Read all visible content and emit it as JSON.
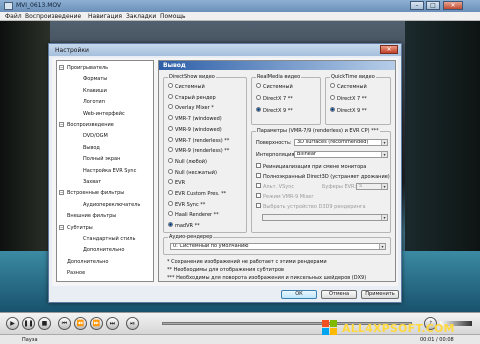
{
  "window": {
    "title": "MVI_0613.MOV",
    "min_label": "–",
    "max_label": "□",
    "close_label": "✕"
  },
  "menu": [
    "Файл",
    "Воспроизведение",
    "Навигация",
    "Закладки",
    "Помощь"
  ],
  "dialog": {
    "title": "Настройки",
    "close_label": "✕",
    "tree": [
      {
        "label": "Проигрыватель",
        "level": 0,
        "expander": "−"
      },
      {
        "label": "Форматы",
        "level": 1
      },
      {
        "label": "Клавиши",
        "level": 1
      },
      {
        "label": "Логотип",
        "level": 1
      },
      {
        "label": "Web-интерфейс",
        "level": 1
      },
      {
        "label": "Воспроизведение",
        "level": 0,
        "expander": "−"
      },
      {
        "label": "DVD/OGM",
        "level": 1
      },
      {
        "label": "Вывод",
        "level": 1
      },
      {
        "label": "Полный экран",
        "level": 1
      },
      {
        "label": "Настройка EVR Sync",
        "level": 1
      },
      {
        "label": "Захват",
        "level": 1
      },
      {
        "label": "Встроенные фильтры",
        "level": 0,
        "expander": "−"
      },
      {
        "label": "Аудиопереключатель",
        "level": 1
      },
      {
        "label": "Внешние фильтры",
        "level": 0
      },
      {
        "label": "Субтитры",
        "level": 0,
        "expander": "−"
      },
      {
        "label": "Стандартный стиль",
        "level": 1
      },
      {
        "label": "Дополнительно",
        "level": 1
      },
      {
        "label": "Дополнительно",
        "level": 0
      },
      {
        "label": "Разное",
        "level": 0
      }
    ],
    "panel_header": "Вывод",
    "directshow": {
      "title": "DirectShow видео",
      "options": [
        {
          "label": "Системный",
          "selected": false
        },
        {
          "label": "Старый рендер",
          "selected": false
        },
        {
          "label": "Overlay Mixer *",
          "selected": false
        },
        {
          "label": "VMR-7 (windowed)",
          "selected": false
        },
        {
          "label": "VMR-9 (windowed)",
          "selected": false
        },
        {
          "label": "VMR-7 (renderless) **",
          "selected": false
        },
        {
          "label": "VMR-9 (renderless) **",
          "selected": false
        },
        {
          "label": "Null (любой)",
          "selected": false
        },
        {
          "label": "Null (несжатый)",
          "selected": false
        },
        {
          "label": "EVR",
          "selected": false
        },
        {
          "label": "EVR Custom Pres. **",
          "selected": false
        },
        {
          "label": "EVR Sync **",
          "selected": false
        },
        {
          "label": "Haali Renderer **",
          "selected": false
        },
        {
          "label": "madVR **",
          "selected": true
        }
      ]
    },
    "realmedia": {
      "title": "RealMedia видео",
      "options": [
        {
          "label": "Системный",
          "selected": false
        },
        {
          "label": "DirectX 7 **",
          "selected": false
        },
        {
          "label": "DirectX 9 **",
          "selected": true
        }
      ]
    },
    "quicktime": {
      "title": "QuickTime видео",
      "options": [
        {
          "label": "Системный",
          "selected": false
        },
        {
          "label": "DirectX 7 **",
          "selected": false
        },
        {
          "label": "DirectX 9 **",
          "selected": true
        }
      ]
    },
    "params": {
      "title": "Параметры (VMR-7/9 (renderless) и EVR CP) ***",
      "surface_label": "Поверхность:",
      "surface_value": "3D surfaces (recommended)",
      "interp_label": "Интерполяция:",
      "interp_value": "Bilinear",
      "reinit_label": "Реинициализация при смене монитора",
      "d3d_label": "Полноэкранный Direct3D (устраняет дрожание)",
      "vsync_label": "Альт. VSync",
      "buffers_label": "Буферы EVR:",
      "buffers_value": "5",
      "vmr9_label": "Режим VMR-9 Mixer",
      "d3d9_label": "Выбрать устройство D3D9 рендеринга"
    },
    "audio": {
      "title": "Аудио-рендерер",
      "value": "0: Системный по умолчанию"
    },
    "notes": [
      "* Сохранение изображений не работает с этими рендерами",
      "** Необходимы для отображения субтитров",
      "*** Необходимы для поворота изображения и пиксельных шейдеров (DX9)"
    ],
    "buttons": {
      "ok": "ОК",
      "cancel": "Отмена",
      "apply": "Применить"
    }
  },
  "status": {
    "state": "Пауза",
    "time": "00:01 / 00:08"
  },
  "watermark": "ALL4XPSOFT.COM",
  "colors": {
    "accent": "#2d5fa8",
    "watermark": "#ffd83c",
    "dialog_bg": "#e9eef4"
  }
}
